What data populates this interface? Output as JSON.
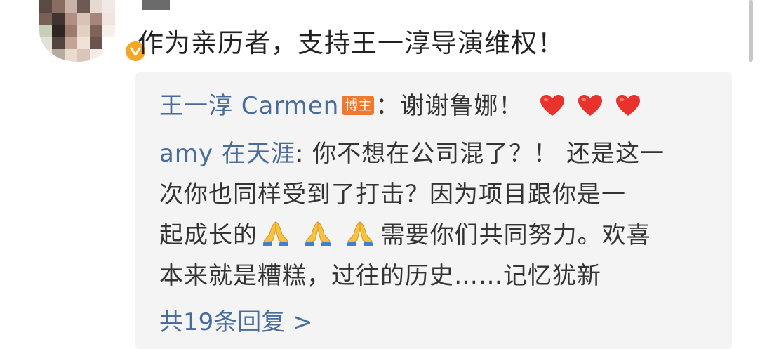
{
  "comment": {
    "text": "作为亲历者，支持王一淳导演维权！"
  },
  "replies": [
    {
      "author": "王一淳 Carmen",
      "badge": "博主",
      "separator": "：",
      "text": "谢谢鲁娜！",
      "emoji": [
        "heart",
        "heart",
        "heart"
      ]
    },
    {
      "author": "amy 在天涯",
      "separator": ": ",
      "lines": [
        "你不想在公司混了？！ 还是这一",
        "次你也同样受到了打击？因为项目跟你是一",
        "起成长的",
        "需要你们共同努力。欢喜",
        "本来就是糟糕，过往的历史……记忆犹新"
      ],
      "emoji": [
        "folded-hands",
        "folded-hands",
        "folded-hands"
      ]
    }
  ],
  "more_replies": "共19条回复 >",
  "colors": {
    "link": "#4a6c9b",
    "badge": "#f0792d",
    "verified": "#f5a623",
    "reply_bg": "#f4f4f4"
  }
}
